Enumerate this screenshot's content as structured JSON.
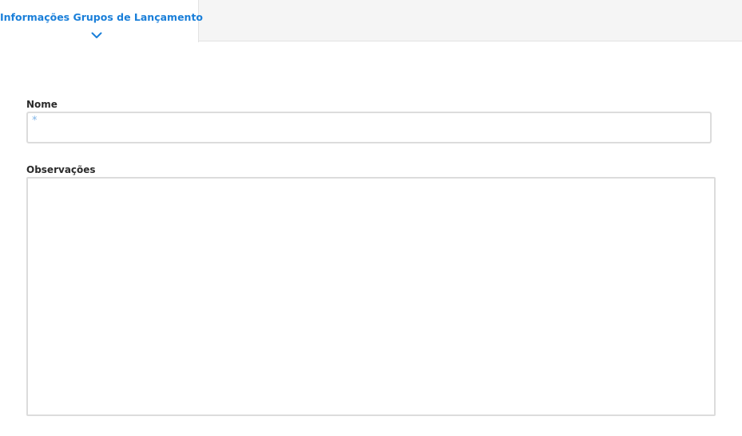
{
  "tabs": [
    {
      "label": "Informações Grupos de Lançamento",
      "active": true,
      "icon": "chevron-down-icon"
    }
  ],
  "colors": {
    "accent": "#1a7fd9",
    "required": "#7fb4e6",
    "border": "#dcdcdc",
    "tabbar_bg": "#f5f5f5"
  },
  "form": {
    "nome": {
      "label": "Nome",
      "value": "",
      "required_marker": "*"
    },
    "observacoes": {
      "label": "Observações",
      "value": ""
    }
  }
}
